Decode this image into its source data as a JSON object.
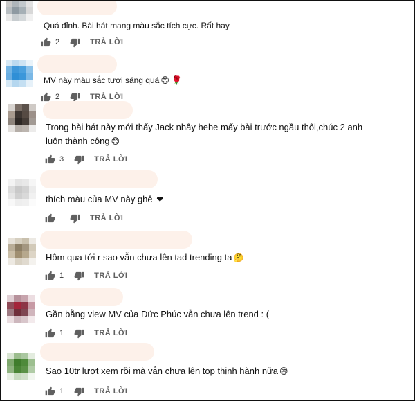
{
  "reply_label": "TRẢ LỜI",
  "comments": [
    {
      "text": "Quá đỉnh. Bài hát mang màu sắc tích cực. Rất hay",
      "emoji": "",
      "likes": "2"
    },
    {
      "text": "MV này màu sắc tươi sáng quá",
      "emoji": "😊 🌹",
      "likes": "2"
    },
    {
      "text": "Trong bài hát này mới thấy Jack nhây hehe mấy bài trước ngầu thôi,chúc 2 anh luôn thành công",
      "emoji": "😊",
      "likes": "3"
    },
    {
      "text": "thích màu của MV này ghê",
      "emoji": "❤",
      "likes": ""
    },
    {
      "text": "Hôm qua tới r sao vẫn chưa lên tad trending ta",
      "emoji": "🤔",
      "likes": "1"
    },
    {
      "text": "Gần bằng view MV của Đức Phúc vẫn chưa lên trend : (",
      "emoji": "",
      "likes": "1"
    },
    {
      "text": "Sao 10tr lượt xem rồi mà vẫn chưa lên top thịnh hành nữa",
      "emoji": "😅",
      "likes": "1"
    }
  ],
  "colors": {
    "name_placeholder": "#fdf1ea",
    "muted": "#606060"
  },
  "icons": {
    "like": "thumbs-up-icon",
    "dislike": "thumbs-down-icon"
  }
}
